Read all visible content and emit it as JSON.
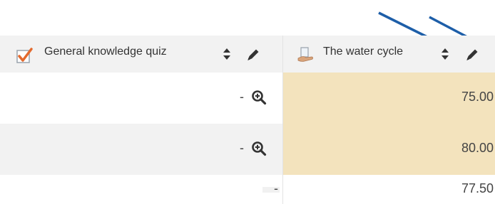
{
  "columns": [
    {
      "label": "General knowledge quiz",
      "icon": "quiz-icon",
      "type": "quiz"
    },
    {
      "label": "The water cycle",
      "icon": "lesson-icon",
      "type": "lesson"
    }
  ],
  "rows": [
    {
      "col1_value": "-",
      "col2_value": "75.00",
      "col2_highlight": true
    },
    {
      "col1_value": "-",
      "col2_value": "80.00",
      "col2_highlight": true
    },
    {
      "col1_value": "-",
      "col2_value": "77.50",
      "col2_highlight": false
    }
  ],
  "colors": {
    "link": "#1a9fd6",
    "highlight": "#f3e3bd",
    "arrow": "#1d5ea8",
    "stripe": "#f2f2f2"
  }
}
